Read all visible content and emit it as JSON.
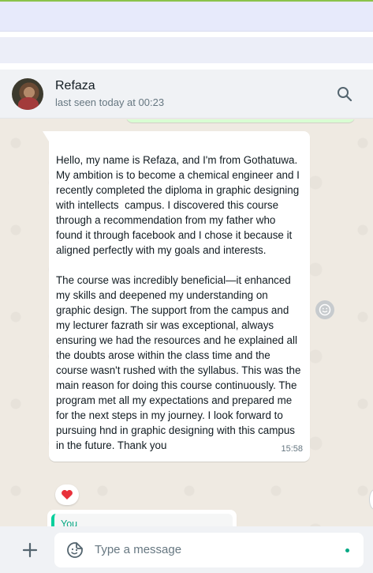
{
  "contact": {
    "name": "Refaza",
    "status": "last seen today at 00:23"
  },
  "message": {
    "text": "Hello, my name is Refaza, and I'm from Gothatuwa. My ambition is to become a chemical engineer and I recently completed the diploma in graphic designing with intellects  campus. I discovered this course through a recommendation from my father who found it through facebook and I chose it because it aligned perfectly with my goals and interests.\n\nThe course was incredibly beneficial—it enhanced my skills and deepened my understanding on graphic design. The support from the campus and my lecturer fazrath sir was exceptional, always ensuring we had the resources and he explained all the doubts arose within the class time and the course wasn't rushed with the syllabus. This was the main reason for doing this course continuously. The program met all my expectations and prepared me for the next steps in my journey. I look forward to pursuing hnd in graphic designing with this campus in the future. Thank you",
    "time": "15:58",
    "reaction": "❤️"
  },
  "quoted": {
    "author": "You"
  },
  "composer": {
    "placeholder": "Type a message"
  },
  "icons": {
    "search": "search-icon",
    "react": "smiley-icon",
    "attach": "plus-icon",
    "emoji": "sticker-icon"
  },
  "colors": {
    "accent": "#00a884",
    "chat_background": "#efeae2",
    "header_background": "#f0f2f5"
  }
}
